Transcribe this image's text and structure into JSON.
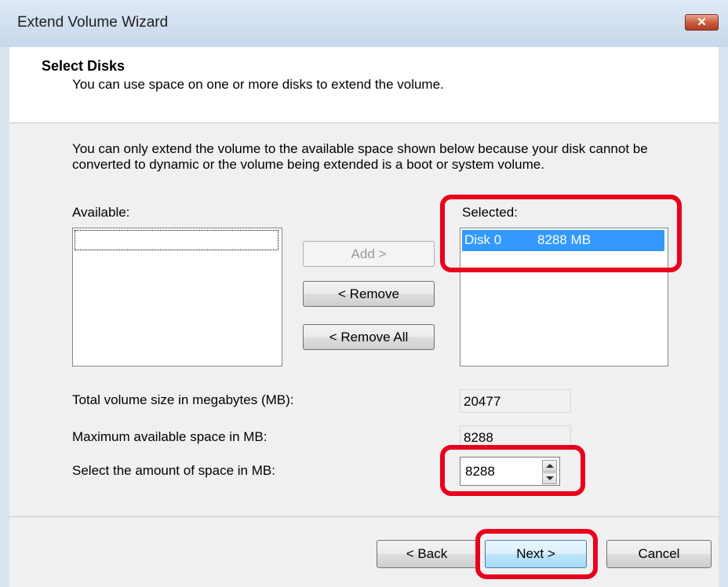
{
  "window": {
    "title": "Extend Volume Wizard",
    "close_glyph": "✕"
  },
  "header": {
    "title": "Select Disks",
    "subtitle": "You can use space on one or more disks to extend the volume."
  },
  "info_text": "You can only extend the volume to the available space shown below because your disk cannot be converted to dynamic or the volume being extended is a boot or system volume.",
  "available": {
    "label": "Available:",
    "items": []
  },
  "selected": {
    "label": "Selected:",
    "items": [
      {
        "disk": "Disk 0",
        "size": "8288 MB"
      }
    ]
  },
  "buttons": {
    "add": "Add >",
    "remove": "< Remove",
    "remove_all": "< Remove All"
  },
  "fields": {
    "total_label": "Total volume size in megabytes (MB):",
    "total_value": "20477",
    "max_label": "Maximum available space in MB:",
    "max_value": "8288",
    "amount_label": "Select the amount of space in MB:",
    "amount_value": "8288"
  },
  "footer": {
    "back": "< Back",
    "next": "Next >",
    "cancel": "Cancel"
  },
  "colors": {
    "highlight": "#e8001c",
    "selection": "#3399ff"
  }
}
